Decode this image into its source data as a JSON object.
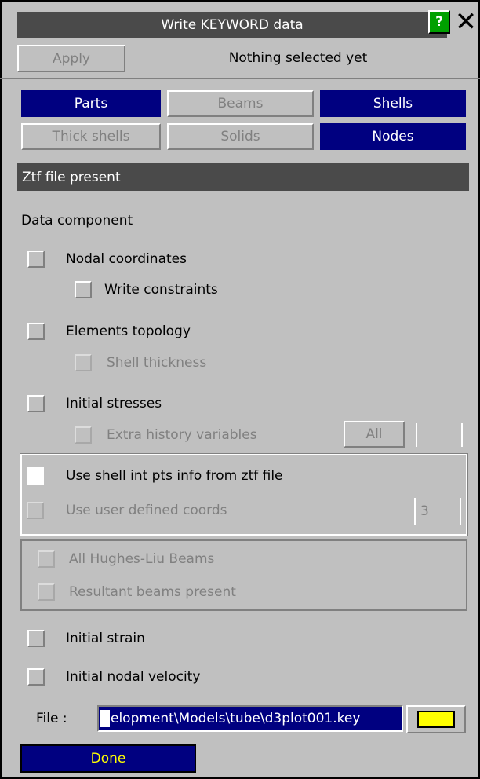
{
  "window": {
    "title": "Write KEYWORD data",
    "help_label": "?",
    "close_label": "✕"
  },
  "toolbar": {
    "apply_label": "Apply",
    "status_text": "Nothing selected yet"
  },
  "entity_buttons": {
    "parts": "Parts",
    "beams": "Beams",
    "shells": "Shells",
    "thick_shells": "Thick shells",
    "solids": "Solids",
    "nodes": "Nodes"
  },
  "ztf_bar": "Ztf file present",
  "data_component": {
    "heading": "Data component",
    "nodal_coordinates": "Nodal coordinates",
    "write_constraints": "Write constraints",
    "elements_topology": "Elements topology",
    "shell_thickness": "Shell thickness",
    "initial_stresses": "Initial stresses",
    "extra_history_variables": "Extra history variables",
    "all_label": "All",
    "use_shell_int_pts": "Use shell int pts info from ztf file",
    "use_user_defined_coords": "Use user defined coords",
    "coords_value": "3",
    "all_hughes_liu": "All Hughes-Liu Beams",
    "resultant_beams": "Resultant beams present",
    "initial_strain": "Initial strain",
    "initial_nodal_velocity": "Initial nodal velocity"
  },
  "file": {
    "label": "File :",
    "value": "elopment\\Models\\tube\\d3plot001.key"
  },
  "done_label": "Done",
  "colors": {
    "active": "#000080",
    "titlebar": "#4a4a4a",
    "help": "#00a000",
    "folder": "#ffff00"
  }
}
